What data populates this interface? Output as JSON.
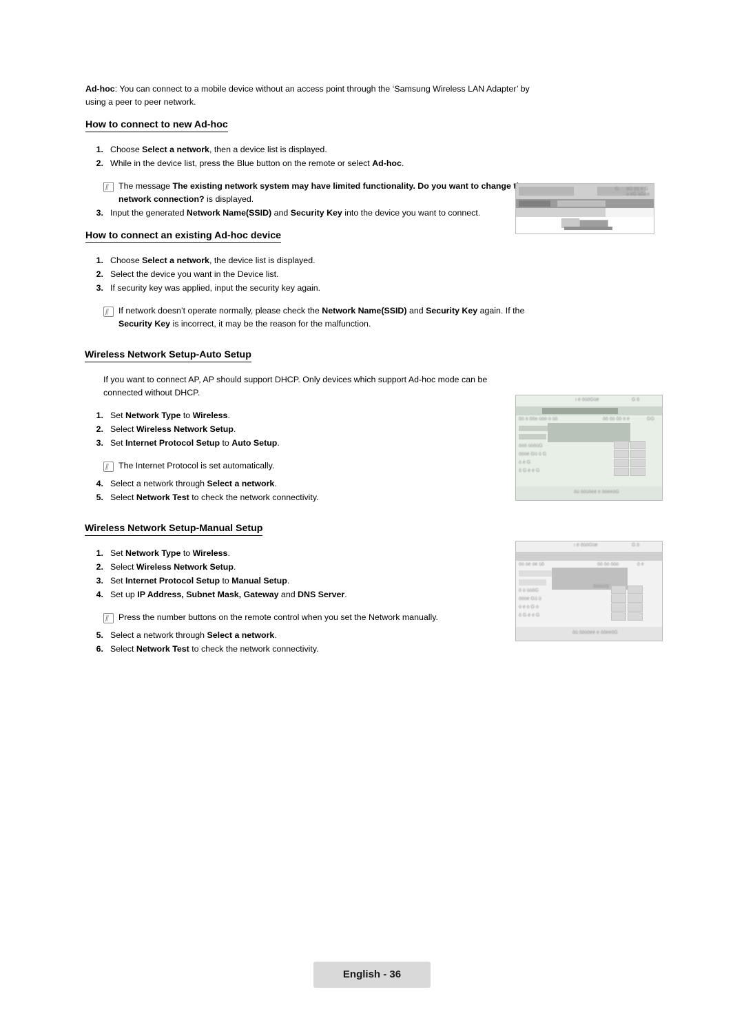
{
  "page": {
    "footer_label": "English - 36"
  },
  "intro": {
    "term": "Ad-hoc",
    "text": ": You can connect to a mobile device without an access point through the ‘Samsung Wireless LAN Adapter’ by using a peer to peer network."
  },
  "sections": [
    {
      "id": "new-adhoc",
      "heading": "How to connect to new Ad-hoc",
      "steps": [
        {
          "num": "1.",
          "parts": [
            {
              "t": "Choose ",
              "b": false
            },
            {
              "t": "Select a network",
              "b": true
            },
            {
              "t": ", then a device list is displayed.",
              "b": false
            }
          ]
        },
        {
          "num": "2.",
          "parts": [
            {
              "t": "While in the device list, press the Blue button on the remote or select ",
              "b": false
            },
            {
              "t": "Ad-hoc",
              "b": true
            },
            {
              "t": ".",
              "b": false
            }
          ]
        }
      ],
      "note": {
        "parts": [
          {
            "t": "The message ",
            "b": false
          },
          {
            "t": "The existing network system may have limited functionality. Do you want to change the network connection?",
            "b": true
          },
          {
            "t": " is displayed.",
            "b": false
          }
        ]
      },
      "steps2": [
        {
          "num": "3.",
          "parts": [
            {
              "t": "Input the generated ",
              "b": false
            },
            {
              "t": "Network Name(SSID)",
              "b": true
            },
            {
              "t": " and ",
              "b": false
            },
            {
              "t": "Security Key",
              "b": true
            },
            {
              "t": " into the device you want to connect.",
              "b": false
            }
          ]
        }
      ]
    },
    {
      "id": "existing-adhoc",
      "heading": "How to connect an existing Ad-hoc device",
      "steps": [
        {
          "num": "1.",
          "parts": [
            {
              "t": "Choose ",
              "b": false
            },
            {
              "t": "Select a network",
              "b": true
            },
            {
              "t": ", the device list is displayed.",
              "b": false
            }
          ]
        },
        {
          "num": "2.",
          "parts": [
            {
              "t": "Select the device you want in the Device list.",
              "b": false
            }
          ]
        },
        {
          "num": "3.",
          "parts": [
            {
              "t": "If security key was applied, input the security key again.",
              "b": false
            }
          ]
        }
      ],
      "note": {
        "parts": [
          {
            "t": "If network doesn’t operate normally, please check the ",
            "b": false
          },
          {
            "t": "Network Name(SSID)",
            "b": true
          },
          {
            "t": " and ",
            "b": false
          },
          {
            "t": "Security Key",
            "b": true
          },
          {
            "t": " again. If the ",
            "b": false
          },
          {
            "t": "Security Key",
            "b": true
          },
          {
            "t": " is incorrect, it may be the reason for the malfunction.",
            "b": false
          }
        ]
      }
    }
  ],
  "auto_setup": {
    "heading": "Wireless Network Setup-Auto Setup",
    "intro": "If you want to connect AP, AP should support DHCP. Only devices which support Ad-hoc mode can be connected without DHCP.",
    "steps": [
      {
        "num": "1.",
        "parts": [
          {
            "t": "Set ",
            "b": false
          },
          {
            "t": "Network Type",
            "b": true
          },
          {
            "t": " to ",
            "b": false
          },
          {
            "t": "Wireless",
            "b": true
          },
          {
            "t": ".",
            "b": false
          }
        ]
      },
      {
        "num": "2.",
        "parts": [
          {
            "t": "Select ",
            "b": false
          },
          {
            "t": "Wireless Network Setup",
            "b": true
          },
          {
            "t": ".",
            "b": false
          }
        ]
      },
      {
        "num": "3.",
        "parts": [
          {
            "t": "Set ",
            "b": false
          },
          {
            "t": "Internet Protocol Setup",
            "b": true
          },
          {
            "t": " to ",
            "b": false
          },
          {
            "t": "Auto Setup",
            "b": true
          },
          {
            "t": ".",
            "b": false
          }
        ]
      }
    ],
    "note": {
      "parts": [
        {
          "t": "The Internet Protocol is set automatically.",
          "b": false
        }
      ]
    },
    "steps2": [
      {
        "num": "4.",
        "parts": [
          {
            "t": "Select a network through ",
            "b": false
          },
          {
            "t": "Select a network",
            "b": true
          },
          {
            "t": ".",
            "b": false
          }
        ]
      },
      {
        "num": "5.",
        "parts": [
          {
            "t": "Select ",
            "b": false
          },
          {
            "t": "Network Test",
            "b": true
          },
          {
            "t": " to check the network connectivity.",
            "b": false
          }
        ]
      }
    ]
  },
  "manual_setup": {
    "heading": "Wireless Network Setup-Manual Setup",
    "steps": [
      {
        "num": "1.",
        "parts": [
          {
            "t": "Set ",
            "b": false
          },
          {
            "t": "Network Type",
            "b": true
          },
          {
            "t": " to ",
            "b": false
          },
          {
            "t": "Wireless",
            "b": true
          },
          {
            "t": ".",
            "b": false
          }
        ]
      },
      {
        "num": "2.",
        "parts": [
          {
            "t": "Select ",
            "b": false
          },
          {
            "t": "Wireless Network Setup",
            "b": true
          },
          {
            "t": ".",
            "b": false
          }
        ]
      },
      {
        "num": "3.",
        "parts": [
          {
            "t": "Set ",
            "b": false
          },
          {
            "t": "Internet Protocol Setup",
            "b": true
          },
          {
            "t": " to ",
            "b": false
          },
          {
            "t": "Manual Setup",
            "b": true
          },
          {
            "t": ".",
            "b": false
          }
        ]
      },
      {
        "num": "4.",
        "parts": [
          {
            "t": "Set up ",
            "b": false
          },
          {
            "t": "IP Address, Subnet Mask, Gateway",
            "b": true
          },
          {
            "t": " and ",
            "b": false
          },
          {
            "t": "DNS Server",
            "b": true
          },
          {
            "t": ".",
            "b": false
          }
        ]
      }
    ],
    "note": {
      "parts": [
        {
          "t": "Press the number buttons on the remote control when you set the Network manually.",
          "b": false
        }
      ]
    },
    "steps2": [
      {
        "num": "5.",
        "parts": [
          {
            "t": "Select a network through ",
            "b": false
          },
          {
            "t": "Select a network",
            "b": true
          },
          {
            "t": ".",
            "b": false
          }
        ]
      },
      {
        "num": "6.",
        "parts": [
          {
            "t": "Select ",
            "b": false
          },
          {
            "t": "Network Test",
            "b": true
          },
          {
            "t": " to check the network connectivity.",
            "b": false
          }
        ]
      }
    ]
  },
  "figures": [
    {
      "id": "fig-adhoc-dialog",
      "caption": ""
    },
    {
      "id": "fig-auto-setup-menu",
      "caption": ""
    },
    {
      "id": "fig-manual-setup-menu",
      "caption": ""
    }
  ]
}
